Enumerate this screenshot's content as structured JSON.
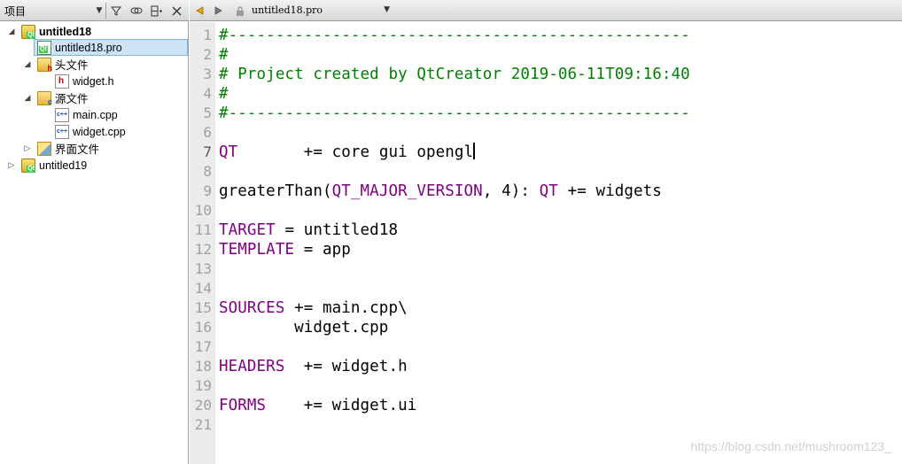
{
  "project_pane": {
    "title": "项目",
    "tree": [
      {
        "label": "untitled18",
        "bold": true
      },
      {
        "label": "untitled18.pro",
        "selected": true
      },
      {
        "label": "头文件"
      },
      {
        "label": "widget.h"
      },
      {
        "label": "源文件"
      },
      {
        "label": "main.cpp"
      },
      {
        "label": "widget.cpp"
      },
      {
        "label": "界面文件"
      },
      {
        "label": "untitled19",
        "bold": true
      }
    ]
  },
  "editor": {
    "open_file": "untitled18.pro",
    "current_line": "7",
    "line_numbers": [
      "1",
      "2",
      "3",
      "4",
      "5",
      "6",
      "7",
      "8",
      "9",
      "10",
      "11",
      "12",
      "13",
      "14",
      "15",
      "16",
      "17",
      "18",
      "19",
      "20",
      "21"
    ],
    "code": {
      "l1": "#-------------------------------------------------",
      "l2": "#",
      "l3": "# Project created by QtCreator 2019-06-11T09:16:40",
      "l4": "#",
      "l5": "#-------------------------------------------------",
      "l7_kw": "QT",
      "l7_rest": "       += core gui opengl",
      "l9_a": "greaterThan(",
      "l9_kw1": "QT_MAJOR_VERSION",
      "l9_b": ", 4): ",
      "l9_kw2": "QT",
      "l9_c": " += widgets",
      "l11_kw": "TARGET",
      "l11_rest": " = untitled18",
      "l12_kw": "TEMPLATE",
      "l12_rest": " = app",
      "l15_kw": "SOURCES",
      "l15_rest": " += main.cpp\\",
      "l16": "        widget.cpp",
      "l18_kw": "HEADERS",
      "l18_rest": "  += widget.h",
      "l20_kw": "FORMS",
      "l20_rest": "    += widget.ui"
    }
  },
  "watermark": "https://blog.csdn.net/mushroom123_",
  "colors": {
    "comment": "#008000",
    "keyword": "#800080",
    "selection": "#cde4f7"
  },
  "icons": [
    "filter-icon",
    "link-icon",
    "split-icon",
    "close-icon",
    "back-arrow-icon",
    "forward-arrow-icon",
    "lock-icon",
    "chevron-down-icon"
  ]
}
